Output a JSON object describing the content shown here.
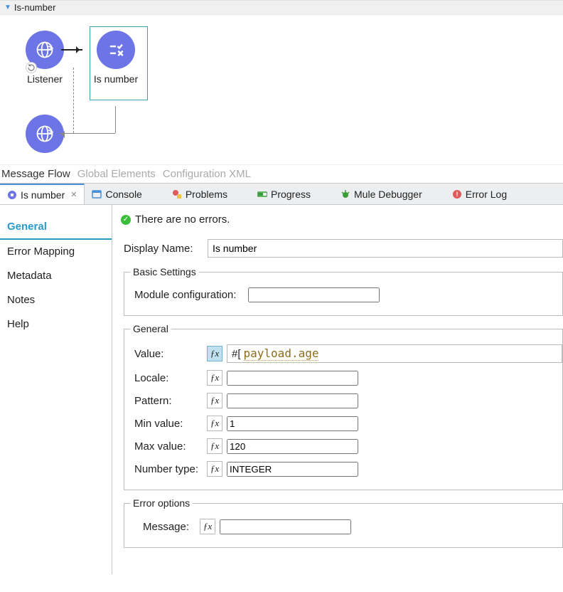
{
  "flow": {
    "name": "Is-number",
    "nodes": {
      "listener": {
        "label": "Listener"
      },
      "isnumber": {
        "label": "Is number"
      }
    }
  },
  "editorTabs": {
    "messageFlow": "Message Flow",
    "globalElements": "Global Elements",
    "configXml": "Configuration XML"
  },
  "views": {
    "isnumber": "Is number",
    "console": "Console",
    "problems": "Problems",
    "progress": "Progress",
    "muleDebugger": "Mule Debugger",
    "errorLog": "Error Log"
  },
  "sideNav": {
    "general": "General",
    "errorMapping": "Error Mapping",
    "metadata": "Metadata",
    "notes": "Notes",
    "help": "Help"
  },
  "status": {
    "text": "There are no errors."
  },
  "form": {
    "displayNameLabel": "Display Name:",
    "displayNameValue": "Is number",
    "basic": {
      "legend": "Basic Settings",
      "moduleConfigLabel": "Module configuration:",
      "moduleConfigValue": ""
    },
    "general": {
      "legend": "General",
      "valueLabel": "Value:",
      "valuePrefix": "#[",
      "valueExpr": "payload.age",
      "localeLabel": "Locale:",
      "localeValue": "",
      "patternLabel": "Pattern:",
      "patternValue": "",
      "minLabel": "Min value:",
      "minValue": "1",
      "maxLabel": "Max value:",
      "maxValue": "120",
      "typeLabel": "Number type:",
      "typeValue": "INTEGER"
    },
    "error": {
      "legend": "Error options",
      "messageLabel": "Message:",
      "messageValue": ""
    }
  }
}
